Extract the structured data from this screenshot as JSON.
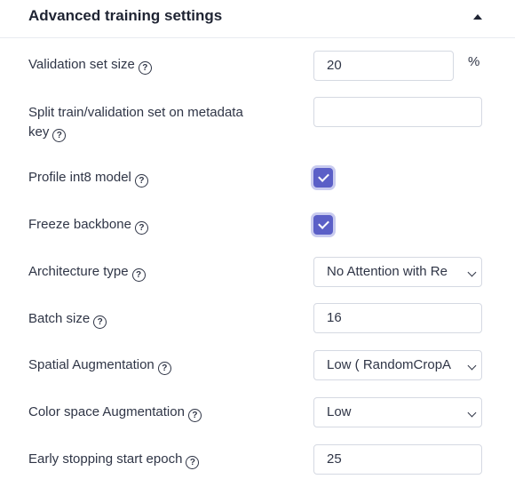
{
  "panel": {
    "title": "Advanced training settings",
    "collapse_icon": "caret-up-icon"
  },
  "settings": {
    "validation_set_size": {
      "label": "Validation set size",
      "value": "20",
      "unit": "%"
    },
    "split_key": {
      "label_line1": "Split train/validation set on metadata",
      "label_line2": "key",
      "value": ""
    },
    "profile_int8": {
      "label": "Profile int8 model",
      "checked": true
    },
    "freeze_backbone": {
      "label": "Freeze backbone",
      "checked": true
    },
    "architecture_type": {
      "label": "Architecture type",
      "value": "No Attention with Re"
    },
    "batch_size": {
      "label": "Batch size",
      "value": "16"
    },
    "spatial_augmentation": {
      "label": "Spatial Augmentation",
      "value": "Low ( RandomCropA"
    },
    "color_space_augmentation": {
      "label": "Color space Augmentation",
      "value": "Low"
    },
    "early_stopping_start_epoch": {
      "label": "Early stopping start epoch",
      "value": "25"
    }
  },
  "help_icon": "?",
  "colors": {
    "accent": "#5b5fc7",
    "border": "#d5d9e2",
    "text": "#2f3546"
  }
}
